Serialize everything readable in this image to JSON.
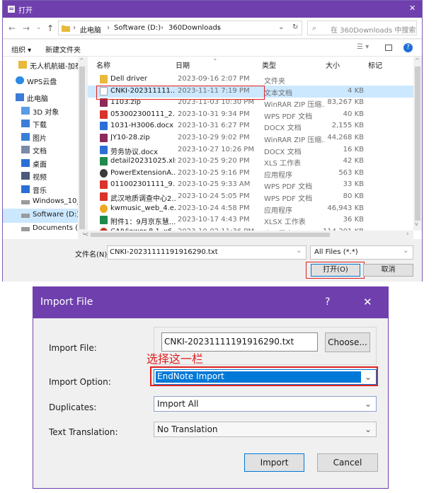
{
  "file_dialog": {
    "title": "打开",
    "close_glyph": "✕",
    "breadcrumb": [
      "此电脑",
      "Software (D:)",
      "360Downloads"
    ],
    "search_placeholder": "在 360Downloads 中搜索",
    "toolbar": {
      "organize": "组织 ▾",
      "new_folder": "新建文件夹"
    },
    "columns": {
      "name": "名称",
      "date": "日期",
      "type": "类型",
      "size": "大小",
      "tag": "标记"
    },
    "nav": [
      {
        "label": "无人机航磁-加泰",
        "icon": "folder-icon"
      },
      {
        "label": "WPS云盘",
        "icon": "cloud-icon"
      },
      {
        "label": "此电脑",
        "icon": "computer-icon"
      },
      {
        "label": "3D 对象",
        "icon": "cube-icon"
      },
      {
        "label": "下载",
        "icon": "download-icon"
      },
      {
        "label": "图片",
        "icon": "picture-icon"
      },
      {
        "label": "文档",
        "icon": "document-icon"
      },
      {
        "label": "桌面",
        "icon": "desktop-icon"
      },
      {
        "label": "视频",
        "icon": "video-icon"
      },
      {
        "label": "音乐",
        "icon": "music-icon"
      },
      {
        "label": "Windows_10_O",
        "icon": "drive-icon"
      },
      {
        "label": "Software (D:)",
        "icon": "drive-icon"
      },
      {
        "label": "Documents (E:)",
        "icon": "drive-icon"
      }
    ],
    "files": [
      {
        "name": "Dell driver",
        "date": "2023-09-16 2:07 PM",
        "type": "文件夹",
        "size": "",
        "icon": "folder-icon",
        "color": "#e8b93a"
      },
      {
        "name": "CNKI-202311111...",
        "date": "2023-11-11 7:19 PM",
        "type": "文本文档",
        "size": "4 KB",
        "icon": "text-file-icon",
        "color": "#9aa4b2"
      },
      {
        "name": "1103.zip",
        "date": "2023-11-03 10:30 PM",
        "type": "WinRAR ZIP 压缩...",
        "size": "83,267 KB",
        "icon": "zip-icon",
        "color": "#8b2a5a"
      },
      {
        "name": "053002300111_2...",
        "date": "2023-10-31 9:34 PM",
        "type": "WPS PDF 文档",
        "size": "40 KB",
        "icon": "pdf-icon",
        "color": "#d9332b"
      },
      {
        "name": "1031-H3006.docx",
        "date": "2023-10-31 6:27 PM",
        "type": "DOCX 文档",
        "size": "2,155 KB",
        "icon": "word-icon",
        "color": "#2b6fd6"
      },
      {
        "name": "JY10-28.zip",
        "date": "2023-10-29 9:02 PM",
        "type": "WinRAR ZIP 压缩...",
        "size": "44,268 KB",
        "icon": "zip-icon",
        "color": "#8b2a5a"
      },
      {
        "name": "劳务协议.docx",
        "date": "2023-10-27 10:26 PM",
        "type": "DOCX 文档",
        "size": "16 KB",
        "icon": "word-icon",
        "color": "#2b6fd6"
      },
      {
        "name": "detail20231025.xls",
        "date": "2023-10-25 9:20 PM",
        "type": "XLS 工作表",
        "size": "42 KB",
        "icon": "excel-icon",
        "color": "#1f8a4c"
      },
      {
        "name": "PowerExtensionA...",
        "date": "2023-10-25 9:16 PM",
        "type": "应用程序",
        "size": "563 KB",
        "icon": "app-icon",
        "color": "#3a3a3a"
      },
      {
        "name": "011002301111_9...",
        "date": "2023-10-25 9:33 AM",
        "type": "WPS PDF 文档",
        "size": "33 KB",
        "icon": "pdf-icon",
        "color": "#d9332b"
      },
      {
        "name": "武汉地质调查中心2...",
        "date": "2023-10-24 5:05 PM",
        "type": "WPS PDF 文档",
        "size": "80 KB",
        "icon": "pdf-icon",
        "color": "#d9332b"
      },
      {
        "name": "kwmusic_web_4.e...",
        "date": "2023-10-24 4:58 PM",
        "type": "应用程序",
        "size": "46,943 KB",
        "icon": "music-app-icon",
        "color": "#f0a820"
      },
      {
        "name": "附件1：9月京东慧...",
        "date": "2023-10-17 4:43 PM",
        "type": "XLSX 工作表",
        "size": "36 KB",
        "icon": "excel-icon",
        "color": "#1f8a4c"
      },
      {
        "name": "CAJViewer 8.1_x6...",
        "date": "2023-10-02 11:36 PM",
        "type": "应用程序",
        "size": "114,201 KB",
        "icon": "app-icon",
        "color": "#c0392b"
      }
    ],
    "filename_label": "文件名(N):",
    "filename_value": "CNKI-20231111191916290.txt",
    "filter_value": "All Files (*.*)",
    "open_button": "打开(O)",
    "cancel_button": "取消"
  },
  "import_dialog": {
    "title": "Import File",
    "help_glyph": "?",
    "close_glyph": "✕",
    "annotation": "选择这一栏",
    "import_file_label": "Import File:",
    "import_file_value": "CNKI-20231111191916290.txt",
    "choose_button": "Choose...",
    "import_option_label": "Import Option:",
    "import_option_value": "EndNote Import",
    "duplicates_label": "Duplicates:",
    "duplicates_value": "Import All",
    "translation_label": "Text Translation:",
    "translation_value": "No Translation",
    "import_button": "Import",
    "cancel_button": "Cancel"
  },
  "colors": {
    "accent": "#6f3fae",
    "highlight_red": "#e02020",
    "selected_blue": "#0078d7"
  }
}
